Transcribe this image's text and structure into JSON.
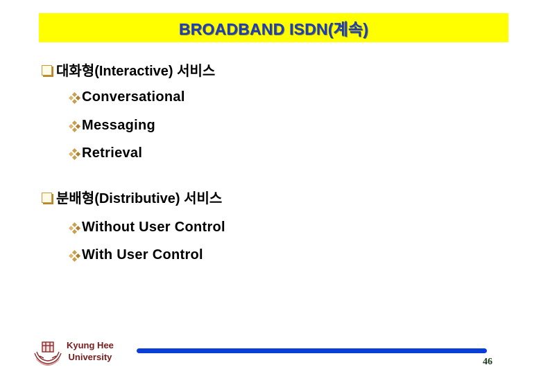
{
  "slide": {
    "title": "BROADBAND ISDN(계속)",
    "colors": {
      "banner_background": "#ffff00",
      "title_text": "#1f3fb0",
      "footer_bar": "#0a3ed8",
      "university_text": "#7a1a1a"
    },
    "sections": [
      {
        "bullet_icon": "hollow-square-bullet",
        "label": "대화형(Interactive) 서비스",
        "items": [
          {
            "bullet_icon": "diamond-cluster-bullet",
            "label": "Conversational"
          },
          {
            "bullet_icon": "diamond-cluster-bullet",
            "label": "Messaging"
          },
          {
            "bullet_icon": "diamond-cluster-bullet",
            "label": "Retrieval"
          }
        ]
      },
      {
        "bullet_icon": "hollow-square-bullet",
        "label": "분배형(Distributive) 서비스",
        "items": [
          {
            "bullet_icon": "diamond-cluster-bullet",
            "label": "Without User Control"
          },
          {
            "bullet_icon": "diamond-cluster-bullet",
            "label": "With User Control"
          }
        ]
      }
    ]
  },
  "footer": {
    "university_line1": "Kyung Hee",
    "university_line2": "University",
    "logo_icon": "university-emblem-icon",
    "page_number": "46"
  }
}
